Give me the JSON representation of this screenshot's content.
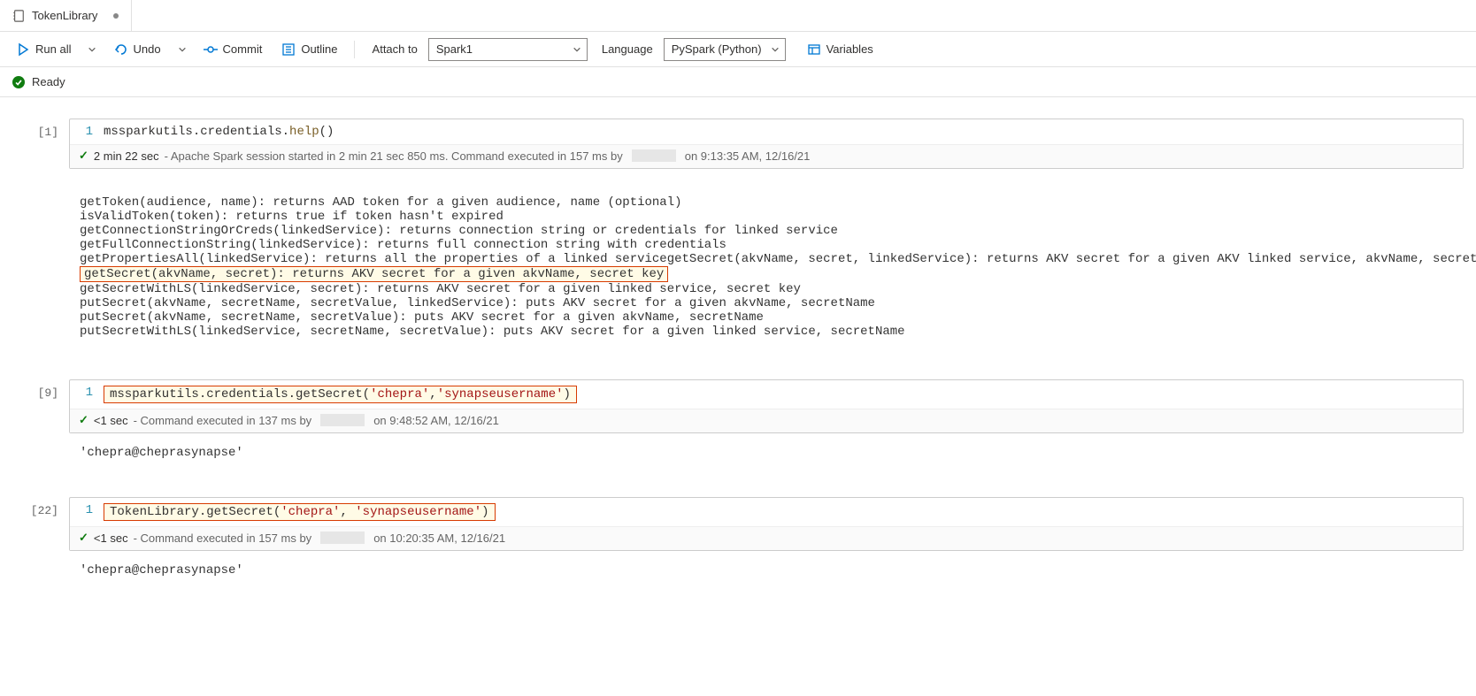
{
  "tab": {
    "title": "TokenLibrary"
  },
  "toolbar": {
    "run_all": "Run all",
    "undo": "Undo",
    "commit": "Commit",
    "outline": "Outline",
    "attach_label": "Attach to",
    "attach_value": "Spark1",
    "language_label": "Language",
    "language_value": "PySpark (Python)",
    "variables": "Variables"
  },
  "status": {
    "text": "Ready"
  },
  "cells": {
    "c1": {
      "label": "[1]",
      "line_no": "1",
      "code_prefix": "mssparkutils.credentials.",
      "code_call": "help",
      "code_suffix": "()",
      "status_time": "2 min 22 sec",
      "status_msg": " - Apache Spark session started in 2 min 21 sec 850 ms. Command executed in 157 ms by ",
      "status_tail": " on 9:13:35 AM, 12/16/21"
    },
    "c9": {
      "label": "[9]",
      "line_no": "1",
      "code_prefix": "mssparkutils.credentials.getSecret(",
      "code_str1": "'chepra'",
      "code_mid": ",",
      "code_str2": "'synapseusername'",
      "code_suffix": ")",
      "status_time": "<1 sec",
      "status_msg": " - Command executed in 137 ms by ",
      "status_tail": " on 9:48:52 AM, 12/16/21",
      "output": "'chepra@cheprasynapse'"
    },
    "c22": {
      "label": "[22]",
      "line_no": "1",
      "code_prefix": "TokenLibrary.getSecret(",
      "code_str1": "'chepra'",
      "code_mid": ", ",
      "code_str2": "'synapseusername'",
      "code_suffix": ")",
      "status_time": "<1 sec",
      "status_msg": " - Command executed in 157 ms by ",
      "status_tail": " on 10:20:35 AM, 12/16/21",
      "output": "'chepra@cheprasynapse'"
    }
  },
  "help_output": {
    "l1": "getToken(audience, name): returns AAD token for a given audience, name (optional)",
    "l2": "isValidToken(token): returns true if token hasn't expired",
    "l3": "getConnectionStringOrCreds(linkedService): returns connection string or credentials for linked service",
    "l4": "getFullConnectionString(linkedService): returns full connection string with credentials",
    "l5": "getPropertiesAll(linkedService): returns all the properties of a linked servicegetSecret(akvName, secret, linkedService): returns AKV secret for a given AKV linked service, akvName, secret key",
    "l6": "getSecret(akvName, secret): returns AKV secret for a given akvName, secret key",
    "l7": "getSecretWithLS(linkedService, secret): returns AKV secret for a given linked service, secret key",
    "l8": "putSecret(akvName, secretName, secretValue, linkedService): puts AKV secret for a given akvName, secretName",
    "l9": "putSecret(akvName, secretName, secretValue): puts AKV secret for a given akvName, secretName",
    "l10": "putSecretWithLS(linkedService, secretName, secretValue): puts AKV secret for a given linked service, secretName"
  }
}
